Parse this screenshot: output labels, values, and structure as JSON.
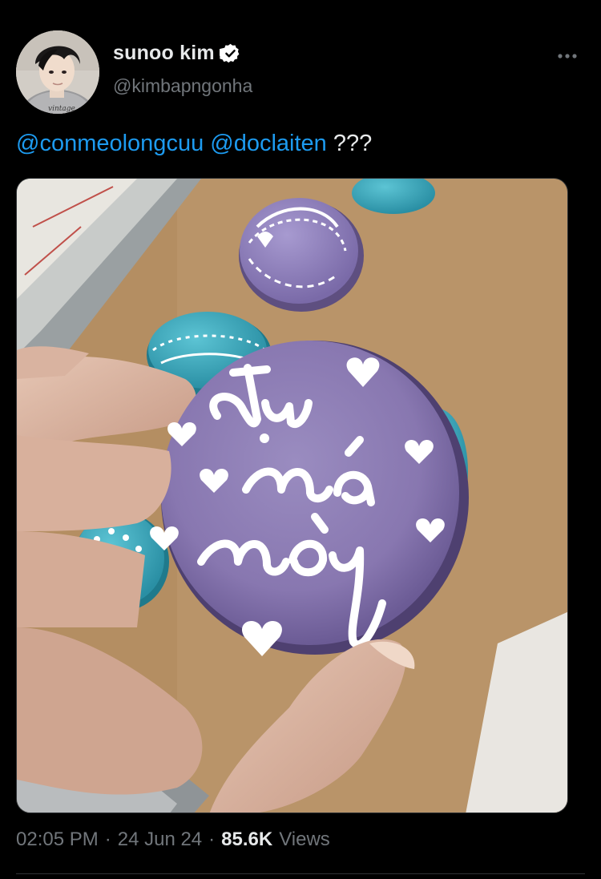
{
  "tweet": {
    "author": {
      "display_name": "sunoo kim",
      "handle": "@kimbapngonha",
      "verified": true,
      "avatar_icon": "profile-avatar"
    },
    "menu_icon": "more-horizontal-icon",
    "text": {
      "mention_1": "@conmeolongcuu",
      "mention_2": "@doclaiten",
      "trailing": "???"
    },
    "media": {
      "type": "photo"
    },
    "meta": {
      "time": "02:05 PM",
      "separator_1": "·",
      "date": "24 Jun 24",
      "separator_2": "·",
      "views_count": "85.6K",
      "views_label": "Views"
    }
  },
  "colors": {
    "background": "#000000",
    "text_primary": "#e7e9ea",
    "text_secondary": "#71767b",
    "link": "#1d9bf0",
    "verified_badge": "#ffffff"
  }
}
